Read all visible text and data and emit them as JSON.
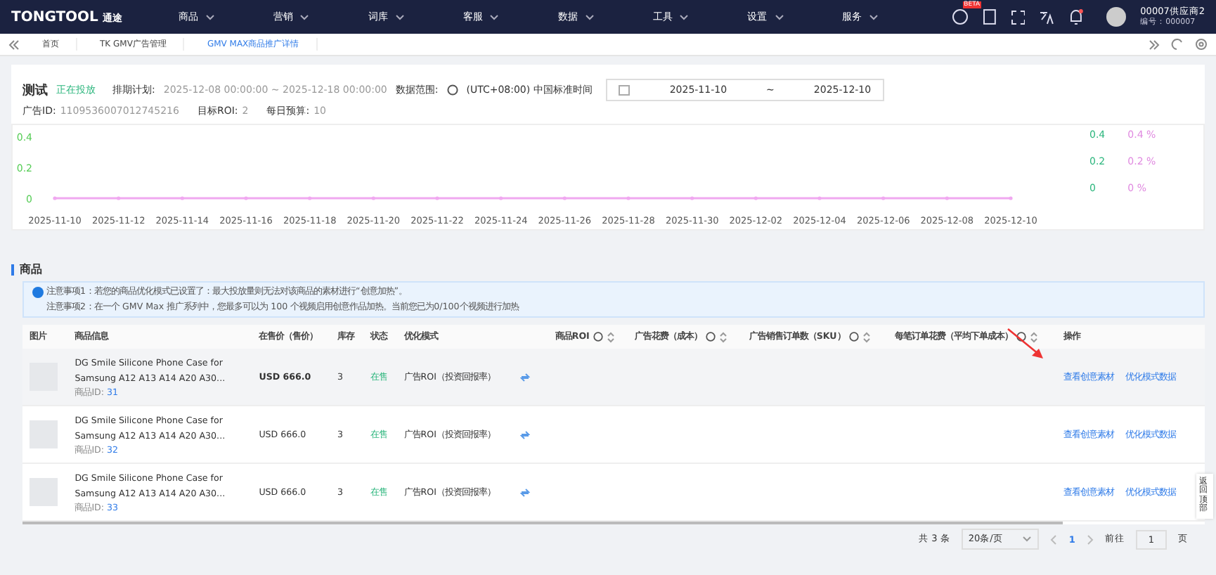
{
  "topnav": {
    "logo": "TONGTOOL",
    "logo_sub": "通途",
    "menu": [
      "商品",
      "营销",
      "词库",
      "客服",
      "数据",
      "工具",
      "设置",
      "服务"
    ],
    "beta": "BETA",
    "user": "00007供应商2",
    "user_id": "编号：000007"
  },
  "breadcrumbs": [
    {
      "label": "首页",
      "selected": false
    },
    {
      "label": "TK GMV广告管理",
      "selected": false
    },
    {
      "label": "GMV MAX商品推广详情",
      "selected": true
    }
  ],
  "campaign": {
    "name": "测试",
    "status": "正在投放",
    "schedule_label": "排期计划:",
    "schedule": "2025-12-08 00:00:00 ~ 2025-12-18 00:00:00",
    "range_label": "数据范围:",
    "timezone": "(UTC+08:00) 中国标准时间",
    "date_from": "2025-11-10",
    "date_sep": "~",
    "date_to": "2025-12-10",
    "ad_id_label": "广告ID:",
    "ad_id": "1109536007012745216",
    "roi_label": "目标ROI:",
    "roi": "2",
    "budget_label": "每日预算:",
    "budget": "10"
  },
  "chart": {
    "right_ticks_1": [
      "0.4",
      "0.2",
      "0"
    ],
    "right_ticks_2": [
      "0.4 %",
      "0.2 %",
      "0 %"
    ],
    "chart_data": {
      "type": "line",
      "categories": [
        "2025-11-10",
        "2025-11-12",
        "2025-11-14",
        "2025-11-16",
        "2025-11-18",
        "2025-11-20",
        "2025-11-22",
        "2025-11-24",
        "2025-11-26",
        "2025-11-28",
        "2025-11-30",
        "2025-12-02",
        "2025-12-04",
        "2025-12-06",
        "2025-12-08",
        "2025-12-10"
      ],
      "ylim": [
        0,
        0.4
      ],
      "yticks": [
        0,
        0.2,
        0.4
      ],
      "series": [
        {
          "color": "#f0a8f0",
          "values": [
            0,
            0,
            0,
            0,
            0,
            0,
            0,
            0,
            0,
            0,
            0,
            0,
            0,
            0,
            0,
            0
          ]
        }
      ]
    }
  },
  "section_title": "商品",
  "notices": [
    "注意事项1：若您的商品优化模式已设置了：最大投放量则无法对该商品的素材进行“创意加热”。",
    "注意事项2：在一个 GMV Max 推广系列中，您最多可以为 100 个视频启用创意作品加热。当前您已为0/100个视频进行加热"
  ],
  "table": {
    "columns": [
      {
        "label": "图片",
        "help": false,
        "sort": false
      },
      {
        "label": "商品信息",
        "help": false,
        "sort": false
      },
      {
        "label": "在售价（售价）",
        "help": false,
        "sort": false
      },
      {
        "label": "库存",
        "help": false,
        "sort": false
      },
      {
        "label": "状态",
        "help": false,
        "sort": false
      },
      {
        "label": "优化模式",
        "help": false,
        "sort": false
      },
      {
        "label": "商品ROI",
        "help": true,
        "sort": true
      },
      {
        "label": "广告花费（成本）",
        "help": true,
        "sort": true
      },
      {
        "label": "广告销售订单数（SKU）",
        "help": true,
        "sort": true
      },
      {
        "label": "每笔订单花费（平均下单成本）",
        "help": true,
        "sort": true
      },
      {
        "label": "操作",
        "help": false,
        "sort": false
      }
    ],
    "rows": [
      {
        "name": "DG Smile Silicone Phone Case for Samsung A12 A13 A14 A20 A30...",
        "id_label": "商品ID:",
        "id": "31",
        "price": "USD 666.0",
        "stock": "3",
        "status": "在售",
        "mode": "广告ROI（投资回报率）",
        "actions": [
          "查看创意素材",
          "优化模式数据"
        ],
        "selected": true
      },
      {
        "name": "DG Smile Silicone Phone Case for Samsung A12 A13 A14 A20 A30...",
        "id_label": "商品ID:",
        "id": "32",
        "price": "USD 666.0",
        "stock": "3",
        "status": "在售",
        "mode": "广告ROI（投资回报率）",
        "actions": [
          "查看创意素材",
          "优化模式数据"
        ],
        "selected": false
      },
      {
        "name": "DG Smile Silicone Phone Case for Samsung A12 A13 A14 A20 A30...",
        "id_label": "商品ID:",
        "id": "33",
        "price": "USD 666.0",
        "stock": "3",
        "status": "在售",
        "mode": "广告ROI（投资回报率）",
        "actions": [
          "查看创意素材",
          "优化模式数据"
        ],
        "selected": false
      }
    ]
  },
  "pagination": {
    "total": "共 3 条",
    "page_size": "20条/页",
    "pages": [
      {
        "label": "1",
        "selected": true
      }
    ],
    "goto_label": "前往",
    "goto": "1",
    "page_unit": "页"
  },
  "back_to_top": "返回顶部"
}
